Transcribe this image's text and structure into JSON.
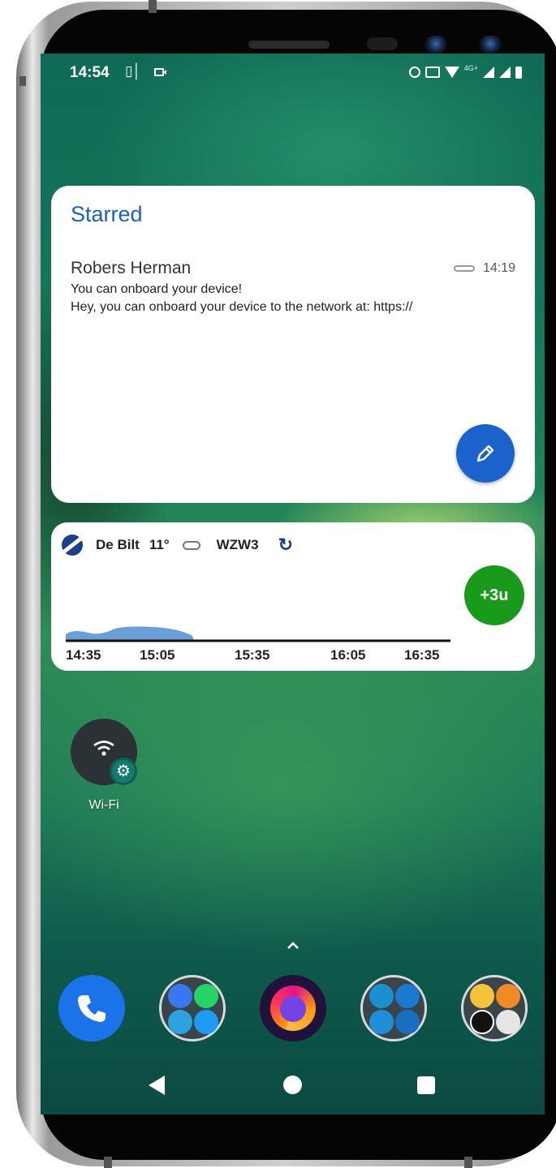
{
  "status_bar": {
    "time": "14:54",
    "network_label": "4G+",
    "icons": [
      "vibrate-icon",
      "screen-record-icon",
      "alarm-icon",
      "cast-icon",
      "wifi-icon",
      "signal-icon",
      "signal-icon",
      "battery-icon"
    ]
  },
  "mail_widget": {
    "title": "Starred",
    "message": {
      "sender": "Robers Herman",
      "time": "14:19",
      "subject": "You can onboard your device!",
      "snippet": "Hey, you can onboard your device to the network at: https://"
    },
    "compose_icon": "pencil-icon",
    "accent_color": "#1c62cc"
  },
  "weather_widget": {
    "location": "De Bilt",
    "temperature": "11°",
    "wind": "WZW3",
    "badge": "+3u",
    "badge_color": "#1a9a1a",
    "time_ticks": [
      "14:35",
      "15:05",
      "15:35",
      "16:05",
      "16:35"
    ]
  },
  "shortcut": {
    "label": "Wi-Fi",
    "icon": "wifi-icon"
  },
  "dock": {
    "apps": [
      "phone-icon",
      "messaging-folder-icon",
      "firefox-icon",
      "travel-folder-icon",
      "banking-folder-icon"
    ]
  },
  "navigation": [
    "back-icon",
    "home-icon",
    "recents-icon"
  ]
}
